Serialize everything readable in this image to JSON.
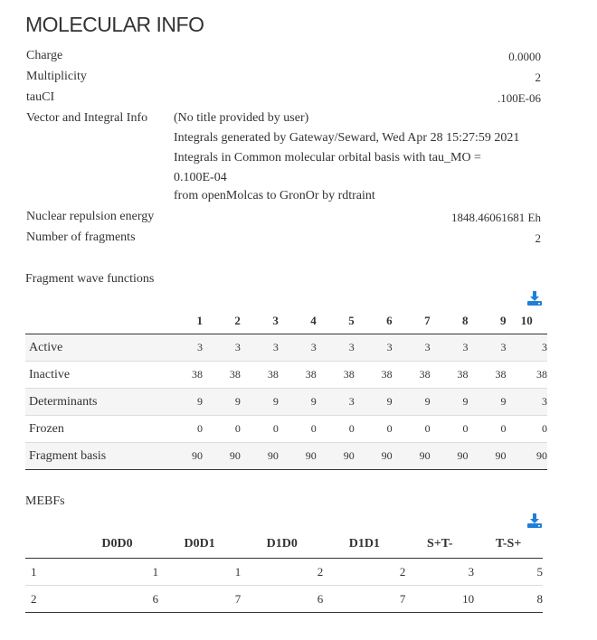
{
  "page": {
    "title": "MOLECULAR INFO"
  },
  "info": {
    "charge_label": "Charge",
    "charge_value": "0.0000",
    "multiplicity_label": "Multiplicity",
    "multiplicity_value": "2",
    "tauci_label": "tauCI",
    "tauci_value": ".100E-06",
    "vector_label": "Vector and Integral Info",
    "vector_lines": [
      "(No title provided by user)",
      "Integrals generated by Gateway/Seward, Wed Apr 28 15:27:59 2021",
      "Integrals in Common molecular orbital basis with tau_MO =",
      "0.100E-04",
      "from openMolcas to GronOr by rdtraint"
    ],
    "nuclear_label": "Nuclear repulsion energy",
    "nuclear_value": "1848.46061681 Eh",
    "fragments_label": "Number of fragments",
    "fragments_value": "2"
  },
  "fragment_wave_functions": {
    "title": "Fragment wave functions",
    "download_icon": "download-icon",
    "columns": [
      "1",
      "2",
      "3",
      "4",
      "5",
      "6",
      "7",
      "8",
      "9",
      "10"
    ],
    "rows": [
      {
        "label": "Active",
        "values": [
          "3",
          "3",
          "3",
          "3",
          "3",
          "3",
          "3",
          "3",
          "3",
          "3"
        ]
      },
      {
        "label": "Inactive",
        "values": [
          "38",
          "38",
          "38",
          "38",
          "38",
          "38",
          "38",
          "38",
          "38",
          "38"
        ]
      },
      {
        "label": "Determinants",
        "values": [
          "9",
          "9",
          "9",
          "9",
          "3",
          "9",
          "9",
          "9",
          "9",
          "3"
        ]
      },
      {
        "label": "Frozen",
        "values": [
          "0",
          "0",
          "0",
          "0",
          "0",
          "0",
          "0",
          "0",
          "0",
          "0"
        ]
      },
      {
        "label": "Fragment basis",
        "values": [
          "90",
          "90",
          "90",
          "90",
          "90",
          "90",
          "90",
          "90",
          "90",
          "90"
        ]
      }
    ]
  },
  "mebfs": {
    "title": "MEBFs",
    "download_icon": "download-icon",
    "columns": [
      "D0D0",
      "D0D1",
      "D1D0",
      "D1D1",
      "S+T-",
      "T-S+"
    ],
    "rows": [
      {
        "label": "1",
        "values": [
          "1",
          "1",
          "2",
          "2",
          "3",
          "5"
        ]
      },
      {
        "label": "2",
        "values": [
          "6",
          "7",
          "6",
          "7",
          "10",
          "8"
        ]
      }
    ]
  },
  "colors": {
    "accent": "#1e7fd9",
    "text": "#333333",
    "stripe": "#f5f5f5"
  }
}
